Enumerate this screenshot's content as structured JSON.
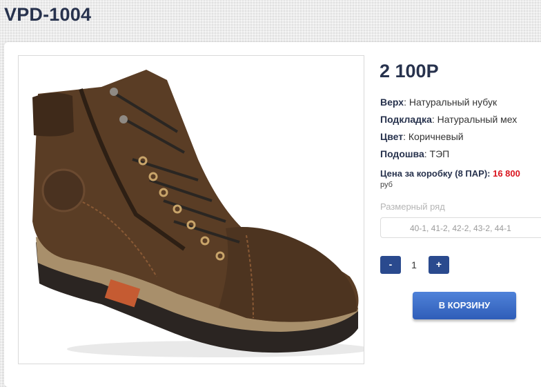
{
  "product": {
    "title": "VPD-1004",
    "price": "2 100Р"
  },
  "attributes": [
    {
      "label": "Верх",
      "value": "Натуральный нубук"
    },
    {
      "label": "Подкладка",
      "value": "Натуральный мех"
    },
    {
      "label": "Цвет",
      "value": "Коричневый"
    },
    {
      "label": "Подошва",
      "value": "ТЭП"
    }
  ],
  "box_price": {
    "label": "Цена за коробку (8 ПАР):",
    "value": "16 800",
    "currency": "руб"
  },
  "sizes": {
    "label": "Размерный ряд",
    "value": "40-1, 41-2, 42-2, 43-2, 44-1"
  },
  "quantity": {
    "minus": "-",
    "value": "1",
    "plus": "+"
  },
  "cart_button": "В КОРЗИНУ",
  "colors": {
    "brand_dark": "#27324d",
    "accent_red": "#d9141e",
    "button_blue": "#2a4a8e"
  }
}
